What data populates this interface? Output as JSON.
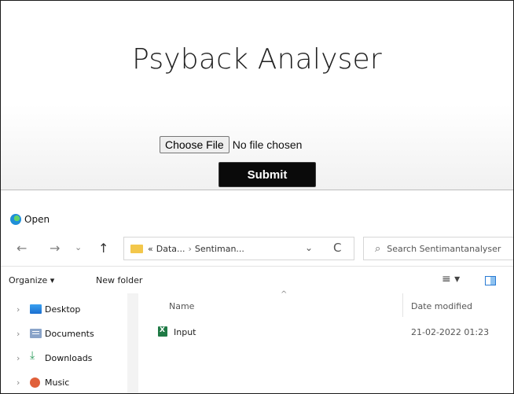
{
  "web": {
    "title": "Psyback Analyser",
    "choose_file_label": "Choose File",
    "file_status": "No file chosen",
    "submit_label": "Submit"
  },
  "dialog": {
    "title": "Open",
    "nav": {
      "back": "←",
      "forward": "→",
      "recent": "⌄",
      "up": "↑"
    },
    "address": {
      "prefix": "«",
      "crumbs": [
        "Data...",
        "Sentiman..."
      ],
      "separator": "›",
      "dropdown": "⌄",
      "refresh": "C"
    },
    "search": {
      "placeholder": "Search Sentimantanalyser",
      "icon": "⌕"
    },
    "commands": {
      "organize": "Organize ▾",
      "new_folder": "New folder",
      "view": "≡ ▾"
    },
    "sidebar": [
      {
        "label": "Desktop",
        "icon": "desktop-icon"
      },
      {
        "label": "Documents",
        "icon": "documents-icon"
      },
      {
        "label": "Downloads",
        "icon": "downloads-icon"
      },
      {
        "label": "Music",
        "icon": "music-icon"
      }
    ],
    "columns": {
      "name": "Name",
      "sort_indicator": "^",
      "date_modified": "Date modified"
    },
    "files": [
      {
        "name": "Input",
        "date": "21-02-2022 01:23"
      }
    ]
  }
}
